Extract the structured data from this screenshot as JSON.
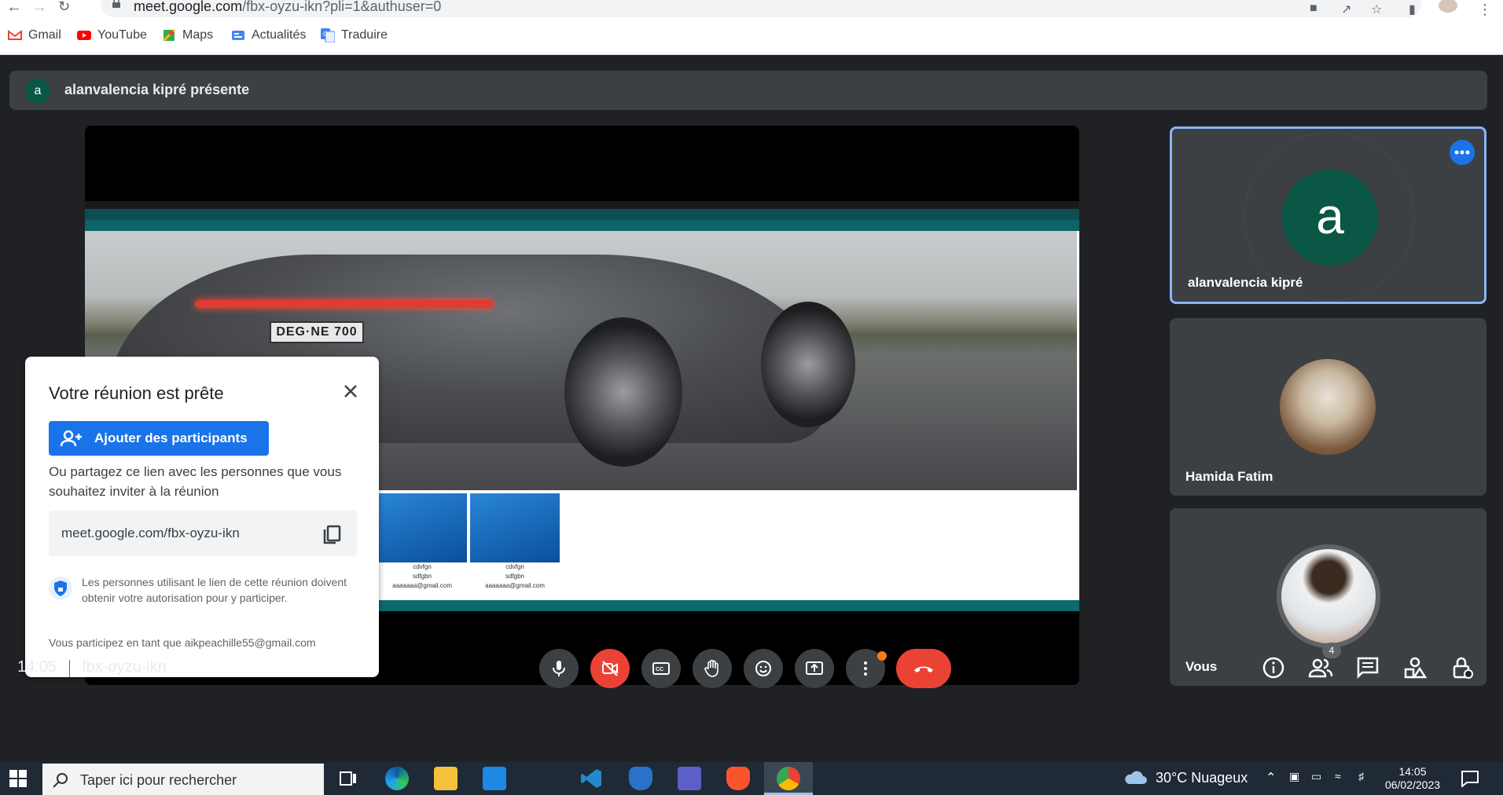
{
  "browser": {
    "url_domain": "meet.google.com",
    "url_path": "/fbx-oyzu-ikn?pli=1&authuser=0"
  },
  "bookmarks": [
    {
      "label": "Gmail",
      "icon": "gmail-icon"
    },
    {
      "label": "YouTube",
      "icon": "youtube-icon"
    },
    {
      "label": "Maps",
      "icon": "maps-icon"
    },
    {
      "label": "Actualités",
      "icon": "news-icon"
    },
    {
      "label": "Traduire",
      "icon": "translate-icon"
    }
  ],
  "presenter_banner": {
    "avatar_letter": "a",
    "text": "alanvalencia kipré présente"
  },
  "shared_screen": {
    "plate": "DEG·NE 700",
    "cards": [
      {
        "line1": "cdvfgn",
        "line2": "sdfgbn",
        "line3": "aaaaaaa@gmail.com"
      },
      {
        "line1": "cdvfgn",
        "line2": "sdfgbn",
        "line3": "aaaaaaa@gmail.com"
      }
    ]
  },
  "dialog": {
    "title": "Votre réunion est prête",
    "add_button": "Ajouter des participants",
    "description": "Ou partagez ce lien avec les personnes que vous souhaitez inviter à la réunion",
    "link": "meet.google.com/fbx-oyzu-ikn",
    "info": "Les personnes utilisant le lien de cette réunion doivent obtenir votre autorisation pour y participer.",
    "joined_as": "Vous participez en tant que aikpeachille55@gmail.com"
  },
  "participants": [
    {
      "name": "alanvalencia kipré",
      "avatar_letter": "a",
      "active": true
    },
    {
      "name": "Hamida Fatim",
      "active": false
    },
    {
      "name": "Vous",
      "active": false
    }
  ],
  "meeting": {
    "time": "14:05",
    "code": "fbx-oyzu-ikn",
    "participant_count": "4"
  },
  "colors": {
    "accent": "#1a73e8",
    "danger": "#ea4335",
    "surface": "#3c4043",
    "background": "#202124"
  },
  "taskbar": {
    "search_placeholder": "Taper ici pour rechercher",
    "weather": "30°C Nuageux",
    "time": "14:05",
    "date": "06/02/2023"
  }
}
